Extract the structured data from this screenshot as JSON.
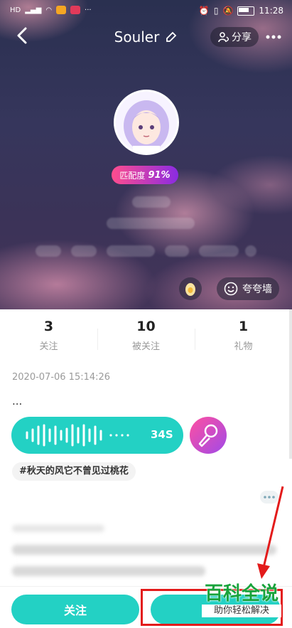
{
  "status_bar": {
    "time": "11:28"
  },
  "header": {
    "title": "Souler",
    "share_label": "分享"
  },
  "profile": {
    "match_label": "匹配度",
    "match_value": "91%"
  },
  "praise_wall_label": "夸夸墙",
  "stats": [
    {
      "num": "3",
      "label": "关注"
    },
    {
      "num": "10",
      "label": "被关注"
    },
    {
      "num": "1",
      "label": "礼物"
    }
  ],
  "post": {
    "date": "2020-07-06 15:14:26",
    "text": "...",
    "voice_duration": "34S",
    "tag": "#秋天的风它不曾见过桃花"
  },
  "bottom": {
    "follow_label": "关注"
  },
  "watermark": {
    "title": "百科全说",
    "subtitle": "助你轻松解决"
  }
}
